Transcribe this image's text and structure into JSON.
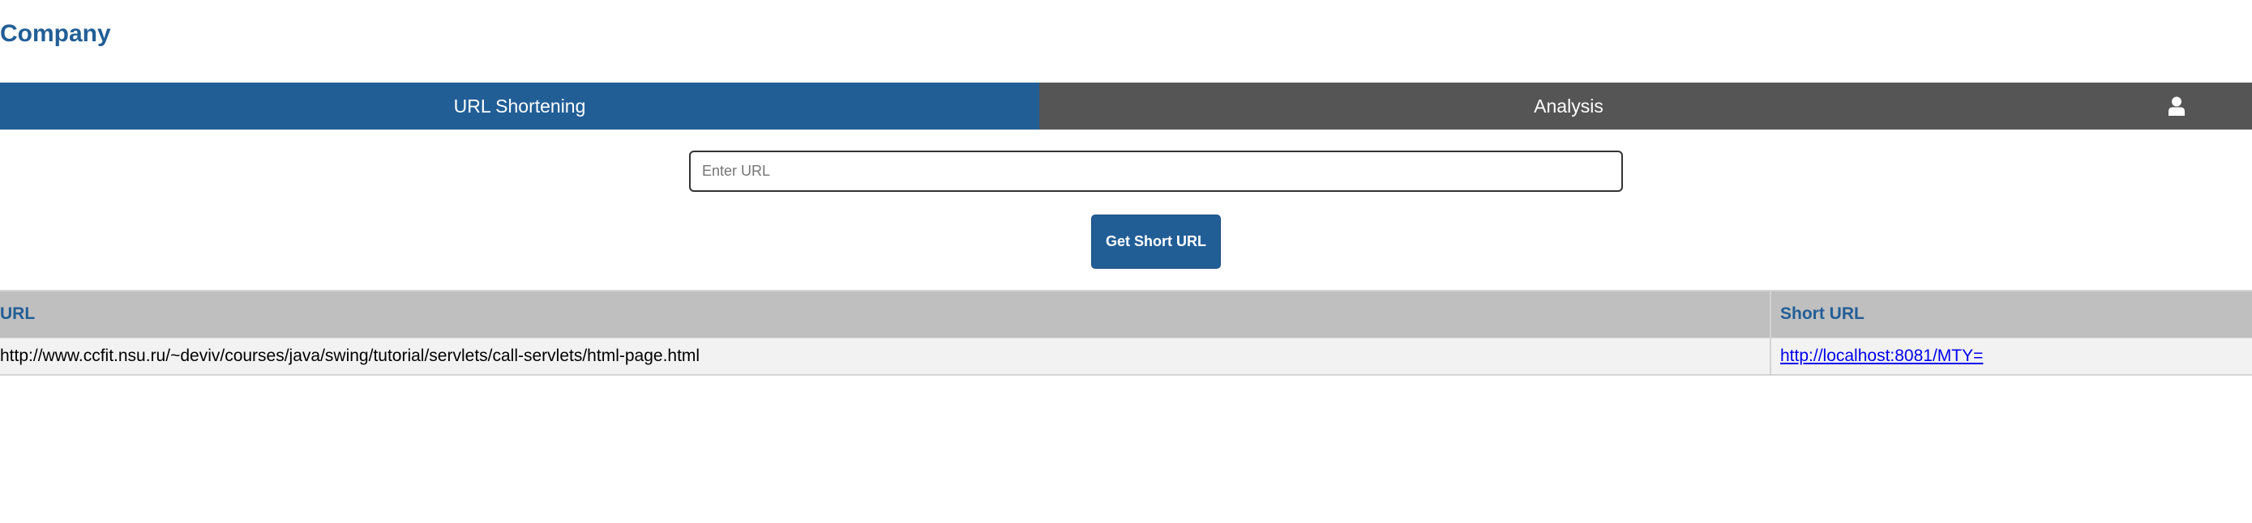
{
  "header": {
    "brand": "Company"
  },
  "nav": {
    "tabs": [
      {
        "label": "URL Shortening",
        "active": true
      },
      {
        "label": "Analysis",
        "active": false
      }
    ],
    "user_icon": "user-icon"
  },
  "form": {
    "url_input": {
      "placeholder": "Enter URL",
      "value": ""
    },
    "submit_label": "Get Short URL"
  },
  "table": {
    "columns": [
      "URL",
      "Short URL"
    ],
    "rows": [
      {
        "url": "http://www.ccfit.nsu.ru/~deviv/courses/java/swing/tutorial/servlets/call-servlets/html-page.html",
        "short_url": "http://localhost:8081/MTY="
      }
    ]
  },
  "colors": {
    "primary": "#225e96",
    "nav_inactive": "#555555",
    "table_header": "#bfbfbf",
    "table_row": "#f2f2f2",
    "link": "#0000ee"
  }
}
